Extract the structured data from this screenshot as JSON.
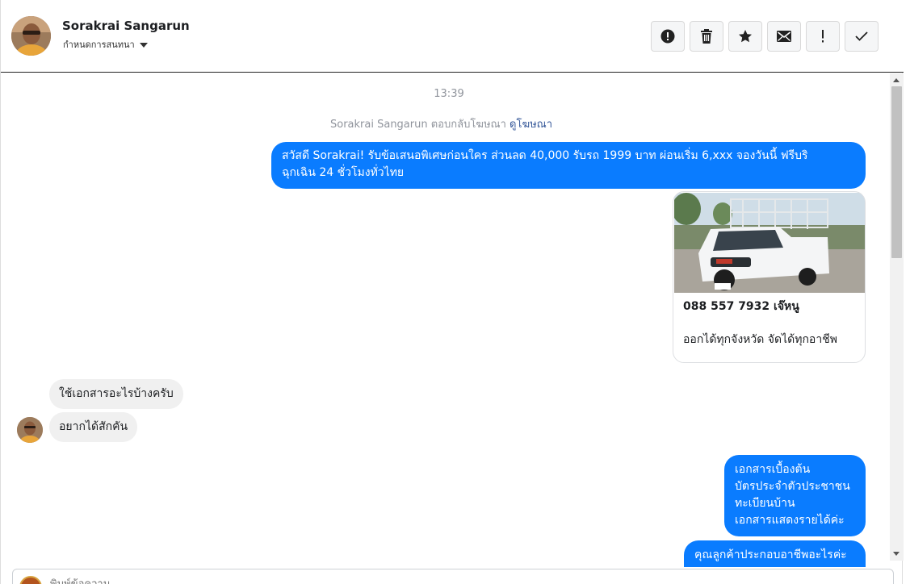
{
  "header": {
    "contact_name": "Sorakrai Sangarun",
    "assign_label": "กำหนดการสนทนา",
    "actions": [
      {
        "name": "report-button",
        "icon": "alert-circle-icon"
      },
      {
        "name": "delete-button",
        "icon": "trash-icon"
      },
      {
        "name": "star-button",
        "icon": "star-icon"
      },
      {
        "name": "mark-unread-button",
        "icon": "envelope-icon"
      },
      {
        "name": "follow-up-button",
        "icon": "exclamation-icon"
      },
      {
        "name": "mark-done-button",
        "icon": "checkmark-icon"
      }
    ]
  },
  "conversation": {
    "timestamp": "13:39",
    "ad_reply_text": "Sorakrai Sangarun ตอบกลับโฆษณา",
    "ad_link": "ดูโฆษณา",
    "messages": {
      "out1": {
        "line1": "สวัสดี Sorakrai! รับข้อเสนอพิเศษก่อนใคร ส่วนลด 40,000 รับรถ 1999 บาท ผ่อนเริ่ม 6,xxx จองวันนี้ ฟรีบริ",
        "line2": "ฉุกเฉิน 24 ชั่วโมงทั่วไทย"
      },
      "card": {
        "title": "088 557 7932 เจ๊หนู",
        "description": "ออกได้ทุกจังหวัด จัดได้ทุกอาชีพ"
      },
      "in1": "ใช้เอกสารอะไรบ้างครับ",
      "in2": "อยากได้สักคัน",
      "out2": [
        "เอกสารเบื้องต้น",
        "บัตรประจำตัวประชาชน",
        "ทะเบียนบ้าน",
        "เอกสารแสดงรายได้ค่ะ"
      ],
      "out3": "คุณลูกค้าประกอบอาชีพอะไรค่ะ"
    }
  },
  "composer": {
    "placeholder": "พิมพ์ข้อความ..."
  },
  "colors": {
    "outgoing_bubble": "#0a7cff",
    "incoming_bubble": "#f0f0f0",
    "link": "#365899"
  }
}
